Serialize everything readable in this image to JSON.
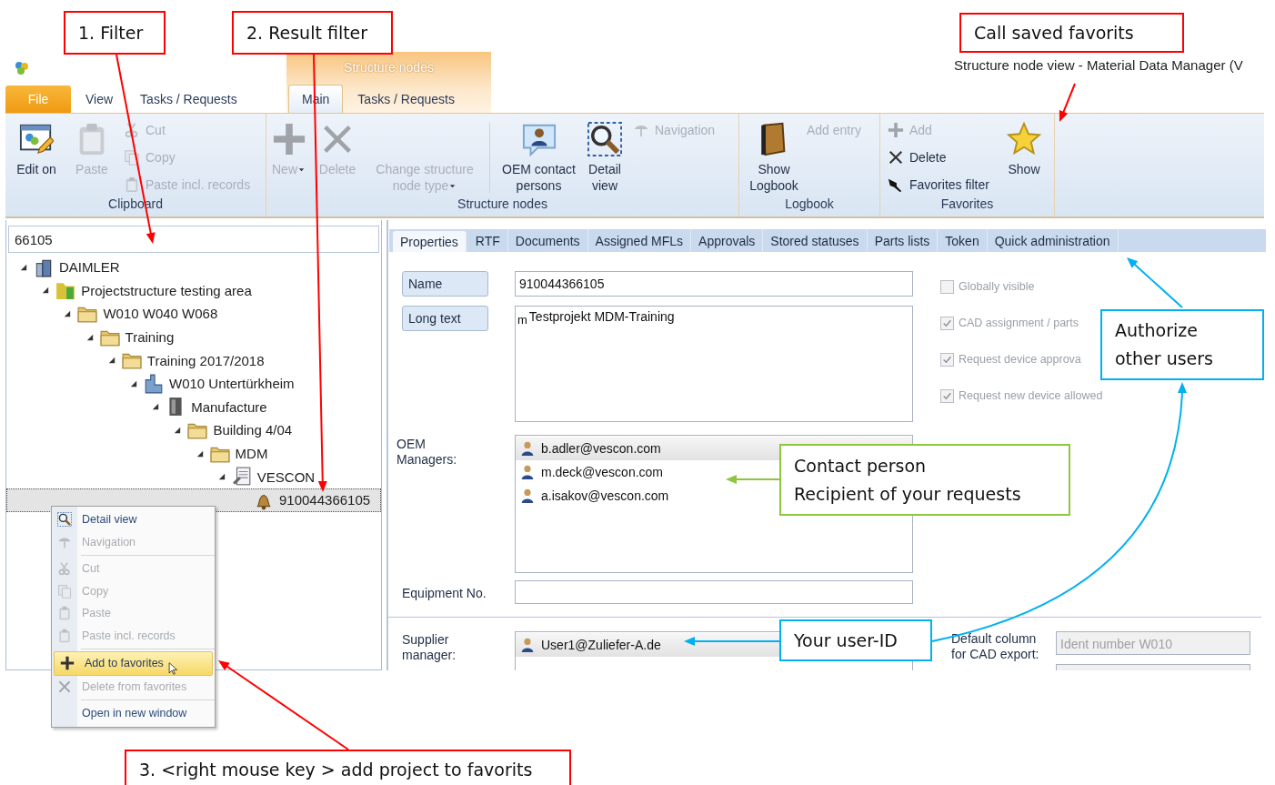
{
  "window_title": "Structure node view - Material Data Manager (V",
  "context_tab_header": "Structure nodes",
  "ribbon_tabs": [
    {
      "label": "File",
      "kind": "file",
      "selected": false
    },
    {
      "label": "View",
      "kind": "plain",
      "selected": false
    },
    {
      "label": "Tasks / Requests",
      "kind": "plain",
      "selected": false
    },
    {
      "label": "Main",
      "kind": "contextual",
      "selected": true
    },
    {
      "label": "Tasks / Requests",
      "kind": "contextual",
      "selected": false
    }
  ],
  "ribbon_groups": [
    {
      "label": "Clipboard",
      "columns": [
        {
          "kind": "large",
          "label": "Edit on",
          "disabled": false,
          "dropdown": false
        },
        {
          "kind": "large",
          "label": "Paste",
          "disabled": true,
          "dropdown": false
        },
        {
          "kind": "stack",
          "items": [
            {
              "label": "Cut",
              "disabled": true
            },
            {
              "label": "Copy",
              "disabled": true
            },
            {
              "label": "Paste incl. records",
              "disabled": true
            }
          ]
        }
      ]
    },
    {
      "label": "Structure nodes",
      "columns": [
        {
          "kind": "large",
          "label": "New",
          "disabled": true,
          "dropdown": true
        },
        {
          "kind": "large",
          "label": "Delete",
          "disabled": true,
          "dropdown": false
        },
        {
          "kind": "large",
          "label": "Change structure node type",
          "disabled": true,
          "dropdown": true
        },
        {
          "kind": "separator"
        },
        {
          "kind": "large",
          "label": "OEM contact persons",
          "disabled": false,
          "dropdown": false
        },
        {
          "kind": "large",
          "label": "Detail view",
          "disabled": false,
          "dropdown": false
        },
        {
          "kind": "stack",
          "items": [
            {
              "label": "Navigation",
              "disabled": true
            }
          ]
        }
      ]
    },
    {
      "label": "Logbook",
      "columns": [
        {
          "kind": "large",
          "label": "Show Logbook",
          "disabled": false,
          "dropdown": false
        },
        {
          "kind": "stack",
          "items": [
            {
              "label": "Add entry",
              "disabled": true
            }
          ]
        }
      ]
    },
    {
      "label": "Favorites",
      "columns": [
        {
          "kind": "stack",
          "items": [
            {
              "label": "Add",
              "disabled": true
            },
            {
              "label": "Delete",
              "disabled": false
            },
            {
              "label": "Favorites filter",
              "disabled": false
            }
          ]
        },
        {
          "kind": "large",
          "label": "Show",
          "disabled": false,
          "dropdown": false
        }
      ]
    }
  ],
  "tree": {
    "filter": "66105",
    "items": [
      {
        "label": "DAIMLER",
        "expanded": true,
        "selected": false,
        "children": [
          {
            "label": "Projectstructure testing area",
            "expanded": true,
            "selected": false,
            "children": [
              {
                "label": "W010 W040 W068",
                "expanded": true,
                "selected": false,
                "children": [
                  {
                    "label": "Training",
                    "expanded": true,
                    "selected": false,
                    "children": [
                      {
                        "label": "Training 2017/2018",
                        "expanded": true,
                        "selected": false,
                        "children": [
                          {
                            "label": "W010 Untertürkheim",
                            "expanded": true,
                            "selected": false,
                            "children": [
                              {
                                "label": "Manufacture",
                                "expanded": true,
                                "selected": false,
                                "children": [
                                  {
                                    "label": "Building 4/04",
                                    "expanded": true,
                                    "selected": false,
                                    "children": [
                                      {
                                        "label": "MDM",
                                        "expanded": true,
                                        "selected": false,
                                        "children": [
                                          {
                                            "label": "VESCON",
                                            "expanded": true,
                                            "selected": false,
                                            "children": [
                                              {
                                                "label": "910044366105",
                                                "expanded": false,
                                                "selected": true
                                              }
                                            ]
                                          }
                                        ]
                                      }
                                    ]
                                  }
                                ]
                              }
                            ]
                          }
                        ]
                      }
                    ]
                  }
                ]
              }
            ]
          }
        ]
      }
    ]
  },
  "detail_tabs": [
    {
      "label": "Properties",
      "selected": true
    },
    {
      "label": "RTF",
      "selected": false
    },
    {
      "label": "Documents",
      "selected": false
    },
    {
      "label": "Assigned MFLs",
      "selected": false
    },
    {
      "label": "Approvals",
      "selected": false
    },
    {
      "label": "Stored statuses",
      "selected": false
    },
    {
      "label": "Parts lists",
      "selected": false
    },
    {
      "label": "Token",
      "selected": false
    },
    {
      "label": "Quick administration",
      "selected": false
    }
  ],
  "properties": {
    "name_label": "Name",
    "name_value": "910044366105",
    "long_text_label": "Long text",
    "long_text_prefix": "m",
    "long_text_value": "Testprojekt MDM-Training",
    "options": [
      {
        "label": "Globally visible",
        "checked": false,
        "disabled": true
      },
      {
        "label": "CAD assignment / parts",
        "checked": true,
        "disabled": true
      },
      {
        "label": "Request device approva",
        "checked": true,
        "disabled": true
      },
      {
        "label": "Request new device allowed",
        "checked": true,
        "disabled": true
      }
    ],
    "oem_managers_label": "OEM Managers:",
    "oem_managers": [
      {
        "email": "b.adler@vescon.com",
        "selected": true
      },
      {
        "email": "m.deck@vescon.com",
        "selected": false
      },
      {
        "email": "a.isakov@vescon.com",
        "selected": false
      }
    ],
    "equipment_label": "Equipment No.",
    "supplier_manager_label": "Supplier manager:",
    "supplier_managers": [
      {
        "email": "User1@Zuliefer-A.de",
        "selected": true
      }
    ],
    "cad_export_label": "Default column for CAD export:",
    "cad_export_value": "Ident number W010"
  },
  "context_menu": [
    {
      "kind": "item",
      "label": "Detail view",
      "disabled": false,
      "selected": false
    },
    {
      "kind": "item",
      "label": "Navigation",
      "disabled": true,
      "selected": false
    },
    {
      "kind": "separator"
    },
    {
      "kind": "item",
      "label": "Cut",
      "disabled": true,
      "selected": false
    },
    {
      "kind": "item",
      "label": "Copy",
      "disabled": true,
      "selected": false
    },
    {
      "kind": "item",
      "label": "Paste",
      "disabled": true,
      "selected": false
    },
    {
      "kind": "item",
      "label": "Paste incl. records",
      "disabled": true,
      "selected": false
    },
    {
      "kind": "separator"
    },
    {
      "kind": "item",
      "label": "Add to favorites",
      "disabled": false,
      "selected": true
    },
    {
      "kind": "item",
      "label": "Delete from favorites",
      "disabled": true,
      "selected": false
    },
    {
      "kind": "separator"
    },
    {
      "kind": "item",
      "label": "Open in new window",
      "disabled": false,
      "selected": false
    }
  ],
  "annotations": [
    {
      "lines": [
        "1. Filter"
      ],
      "color": "#ff0000"
    },
    {
      "lines": [
        "2. Result filter"
      ],
      "color": "#ff0000"
    },
    {
      "lines": [
        "Call saved favorits"
      ],
      "color": "#ff0000"
    },
    {
      "lines": [
        "Authorize",
        "other users"
      ],
      "color": "#00b0f0"
    },
    {
      "lines": [
        "Contact person",
        "Recipient of your requests"
      ],
      "color": "#8dc63f"
    },
    {
      "lines": [
        "Your user-ID"
      ],
      "color": "#00b0f0"
    },
    {
      "lines": [
        "3. <right mouse key > add project to favorits"
      ],
      "color": "#ff0000"
    }
  ]
}
